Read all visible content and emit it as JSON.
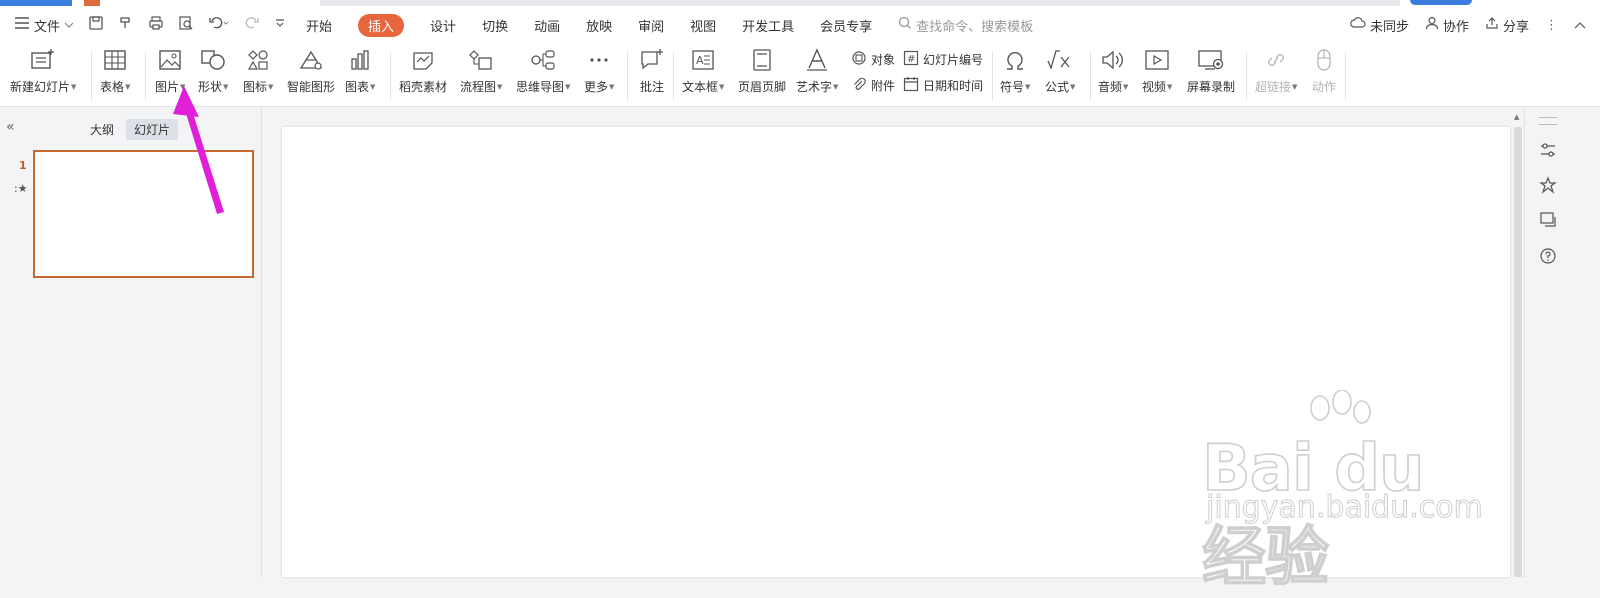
{
  "menubar": {
    "file_label": "文件",
    "tabs": [
      {
        "label": "开始",
        "active": false
      },
      {
        "label": "插入",
        "active": true
      },
      {
        "label": "设计",
        "active": false
      },
      {
        "label": "切换",
        "active": false
      },
      {
        "label": "动画",
        "active": false
      },
      {
        "label": "放映",
        "active": false
      },
      {
        "label": "审阅",
        "active": false
      },
      {
        "label": "视图",
        "active": false
      },
      {
        "label": "开发工具",
        "active": false
      },
      {
        "label": "会员专享",
        "active": false
      }
    ],
    "search_placeholder": "查找命令、搜索模板",
    "sync_label": "未同步",
    "collab_label": "协作",
    "share_label": "分享"
  },
  "ribbon": {
    "new_slide": "新建幻灯片",
    "table": "表格",
    "picture": "图片",
    "shape": "形状",
    "icon": "图标",
    "smartart": "智能图形",
    "chart": "图表",
    "docer": "稻壳素材",
    "flowchart": "流程图",
    "mindmap": "思维导图",
    "more": "更多",
    "comment": "批注",
    "textbox": "文本框",
    "header_footer": "页眉页脚",
    "wordart": "艺术字",
    "object": "对象",
    "slide_number": "幻灯片编号",
    "attachment": "附件",
    "datetime": "日期和时间",
    "symbol": "符号",
    "formula": "公式",
    "audio": "音频",
    "video": "视频",
    "screen_record": "屏幕录制",
    "hyperlink": "超链接",
    "action": "动作"
  },
  "leftpane": {
    "outline_tab": "大纲",
    "slides_tab": "幻灯片",
    "slide_number": "1"
  },
  "watermark": {
    "main": "Bai du 经验",
    "sub": "jingyan.baidu.com"
  },
  "colors": {
    "accent": "#e8663d",
    "thumb_border": "#c46a2f",
    "annotation_arrow": "#e020d8"
  }
}
